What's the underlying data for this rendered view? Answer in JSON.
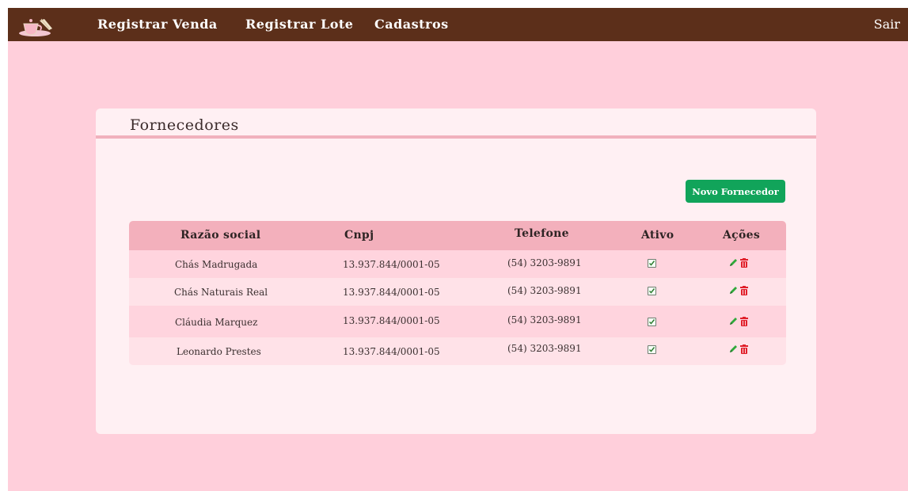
{
  "navbar": {
    "links": [
      "Registrar Venda",
      "Registrar Lote",
      "Cadastros"
    ],
    "logout": "Sair"
  },
  "page": {
    "title": "Fornecedores",
    "new_button": "Novo Fornecedor"
  },
  "table": {
    "headers": [
      "Razão social",
      "Cnpj",
      "Telefone",
      "Ativo",
      "Ações"
    ],
    "rows": [
      {
        "razao": "Chás Madrugada",
        "cnpj": "13.937.844/0001-05",
        "telefone": "(54) 3203-9891",
        "ativo": true
      },
      {
        "razao": "Chás Naturais Real",
        "cnpj": "13.937.844/0001-05",
        "telefone": "(54) 3203-9891",
        "ativo": true
      },
      {
        "razao": "Cláudia Marquez",
        "cnpj": "13.937.844/0001-05",
        "telefone": "(54) 3203-9891",
        "ativo": true
      },
      {
        "razao": "Leonardo Prestes",
        "cnpj": "13.937.844/0001-05",
        "telefone": "(54) 3203-9891",
        "ativo": true
      }
    ]
  },
  "icons": {
    "logo": "teacup-logo-icon",
    "edit": "pencil-icon",
    "delete": "trash-icon",
    "active": "checkbox-checked-icon"
  },
  "colors": {
    "navbar": "#5c2f1a",
    "background": "#ffcfdb",
    "card": "#fff0f3",
    "accent": "#11a45a",
    "delete": "#e0202a"
  }
}
